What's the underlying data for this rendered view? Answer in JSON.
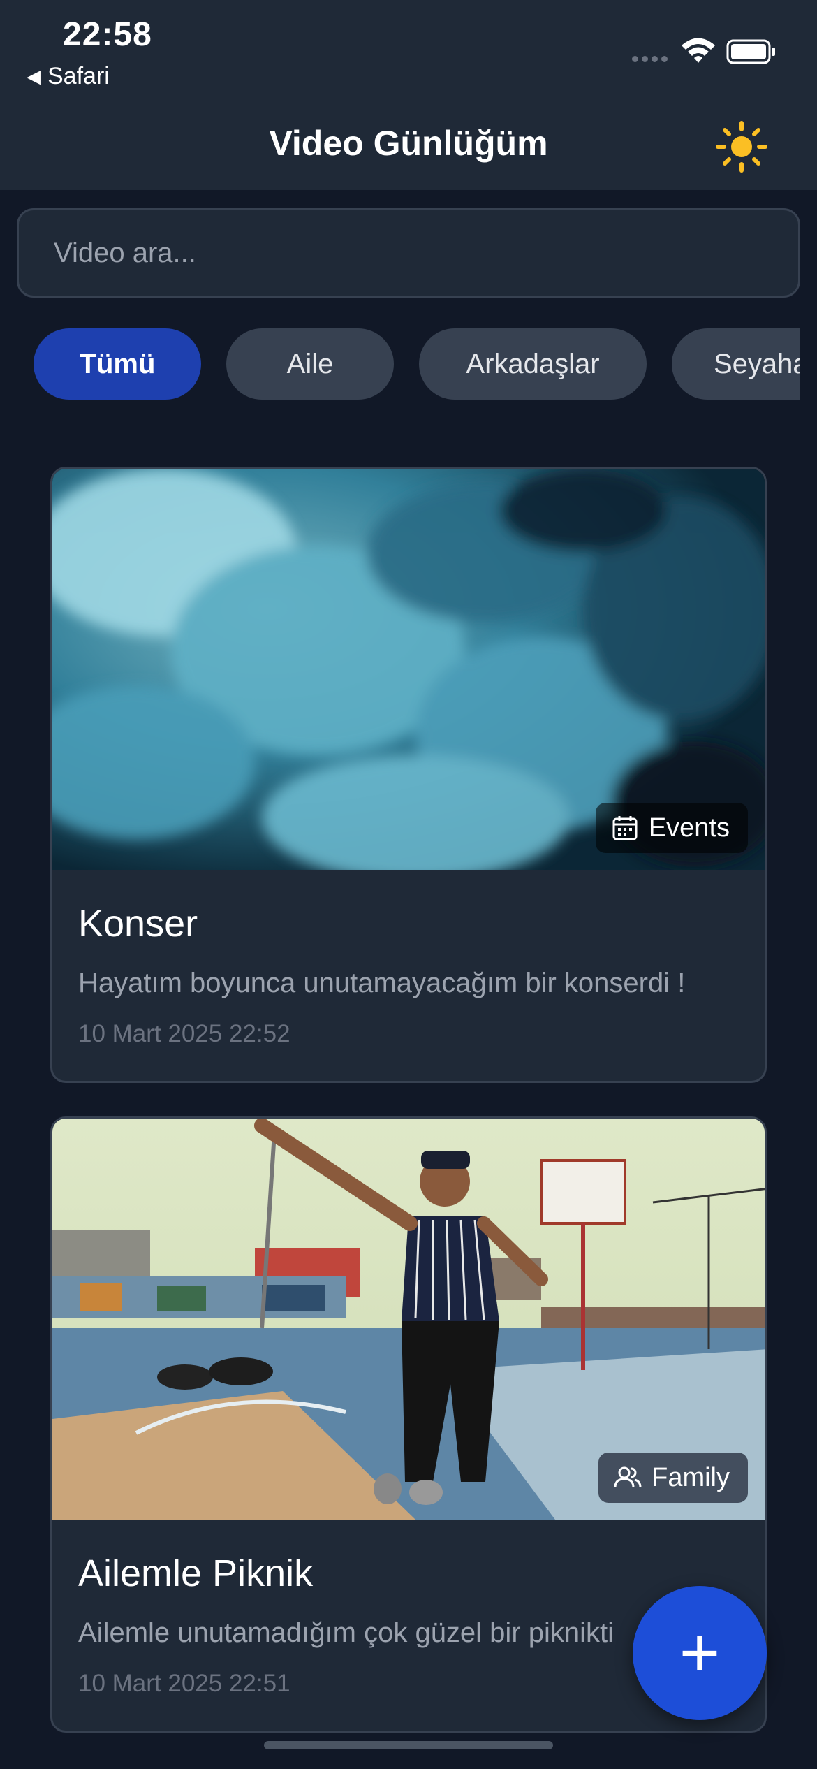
{
  "status_bar": {
    "time": "22:58",
    "back_app": "Safari",
    "icons": [
      "cellular-signal-icon",
      "wifi-icon",
      "battery-icon"
    ]
  },
  "header": {
    "title": "Video Günlüğüm",
    "theme_icon": "sun-icon"
  },
  "search": {
    "placeholder": "Video ara...",
    "value": ""
  },
  "filters": [
    {
      "label": "Tümü",
      "active": true
    },
    {
      "label": "Aile",
      "active": false
    },
    {
      "label": "Arkadaşlar",
      "active": false
    },
    {
      "label": "Seyahat",
      "active": false
    }
  ],
  "videos": [
    {
      "title": "Konser",
      "description": "Hayatım boyunca unutamayacağım bir konserdi !",
      "date": "10 Mart 2025 22:52",
      "category": "Events",
      "category_icon": "calendar-icon",
      "thumbnail": "blue-smoke-image"
    },
    {
      "title": "Ailemle Piknik",
      "description": "Ailemle unutamadığım çok güzel bir piknikti",
      "date": "10 Mart 2025 22:51",
      "category": "Family",
      "category_icon": "users-icon",
      "thumbnail": "basketball-court-dancer-image"
    }
  ],
  "fab": {
    "label": "+"
  },
  "colors": {
    "background": "#111827",
    "surface": "#1f2937",
    "border": "#374151",
    "accent": "#1e40af",
    "fab": "#1d4ed8",
    "sun": "#fbbf24",
    "muted_text": "#9ca3af"
  }
}
